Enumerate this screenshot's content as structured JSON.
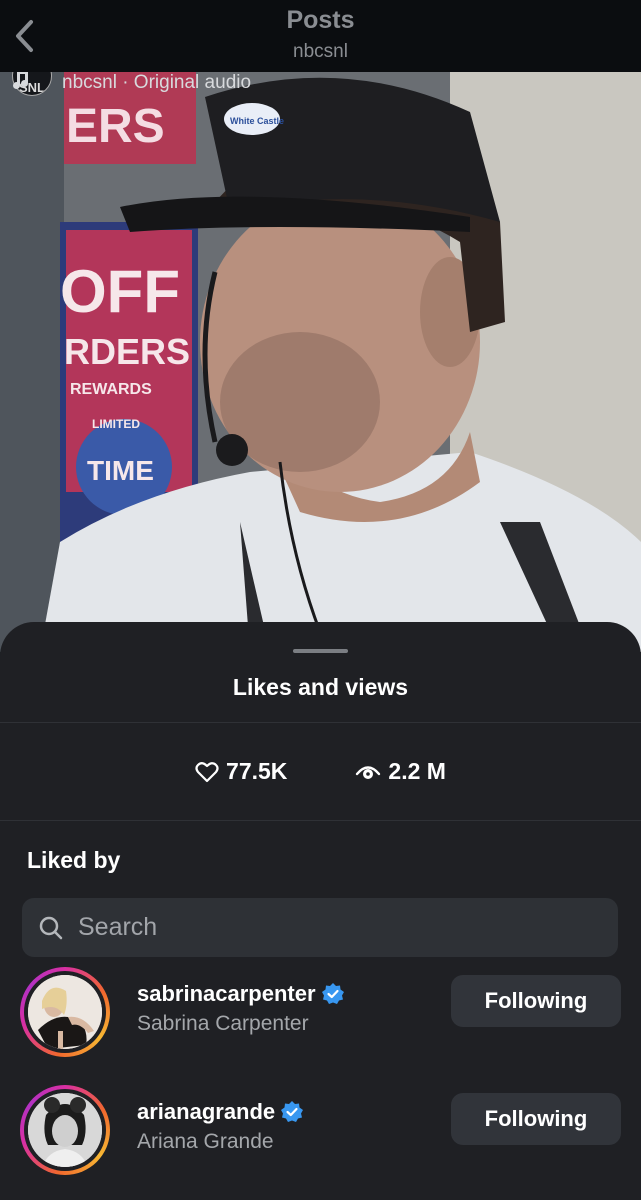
{
  "header": {
    "title": "Posts",
    "subtitle": "nbcsnl"
  },
  "icons": {
    "back": "chevron-left-icon",
    "note": "music-note-icon",
    "like": "heart-icon",
    "views": "eye-icon",
    "search": "search-icon",
    "verified": "verified-badge-icon"
  },
  "video": {
    "account": "nbcsnl",
    "audio": "Original audio",
    "audio_line": "nbcsnl · Original audio",
    "avatar_text": "SNL",
    "sign_1": "ERS",
    "sign_2": "OFF",
    "sign_3": "RDERS",
    "sign_4": "REWARDS",
    "sign_5": "TIME",
    "sign_6": "LIMITED",
    "cap_logo": "White Castle"
  },
  "sheet": {
    "title": "Likes and views",
    "likes": "77.5K",
    "views": "2.2 M",
    "liked_by_label": "Liked by",
    "search_placeholder": "Search",
    "users": [
      {
        "username": "sabrinacarpenter",
        "full_name": "Sabrina Carpenter",
        "button": "Following",
        "verified": true
      },
      {
        "username": "arianagrande",
        "full_name": "Ariana Grande",
        "button": "Following",
        "verified": true
      }
    ]
  },
  "colors": {
    "top_bar": "#0b0d10",
    "sheet": "#1f2024",
    "button": "#31343a",
    "verified": "#3897f0",
    "muted_text": "#a4a7ab"
  }
}
